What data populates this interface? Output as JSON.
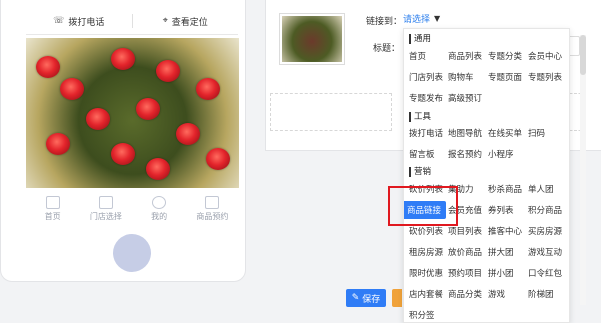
{
  "phone": {
    "call_label": "拨打电话",
    "locate_label": "查看定位",
    "nav": [
      "首页",
      "门店选择",
      "我的",
      "商品预约"
    ]
  },
  "panel": {
    "link_label": "链接到：",
    "link_value": "请选择",
    "title_label": "标题："
  },
  "save_label": "保存",
  "dropdown": {
    "sections": [
      "通用",
      "工具",
      "营销"
    ],
    "rows": [
      [
        "首页",
        "商品列表",
        "专题分类",
        "会员中心"
      ],
      [
        "门店列表",
        "购物车",
        "专题页面",
        "专题列表"
      ],
      [
        "专题发布",
        "高级预订"
      ],
      [
        "拨打电话",
        "地图导航",
        "在线买单",
        "扫码"
      ],
      [
        "留言板",
        "报名预约",
        "小程序"
      ],
      [
        "砍价列表",
        "集助力",
        "秒杀商品",
        "单人团"
      ],
      [
        "商品链接",
        "会员充值",
        "券列表",
        "积分商品"
      ],
      [
        "砍价列表",
        "项目列表",
        "推客中心",
        "买房房源"
      ],
      [
        "租房房源",
        "放价商品",
        "拼大团",
        "游戏互动"
      ],
      [
        "限时优惠",
        "预约项目",
        "拼小团",
        "口令红包"
      ],
      [
        "店内套餐",
        "商品分类",
        "游戏",
        "阶梯团"
      ],
      [
        "积分签",
        "",
        "",
        ""
      ]
    ],
    "highlighted": "商品链接"
  },
  "colors": {
    "accent": "#2f7cf6",
    "highlight_frame": "#e0181f"
  }
}
